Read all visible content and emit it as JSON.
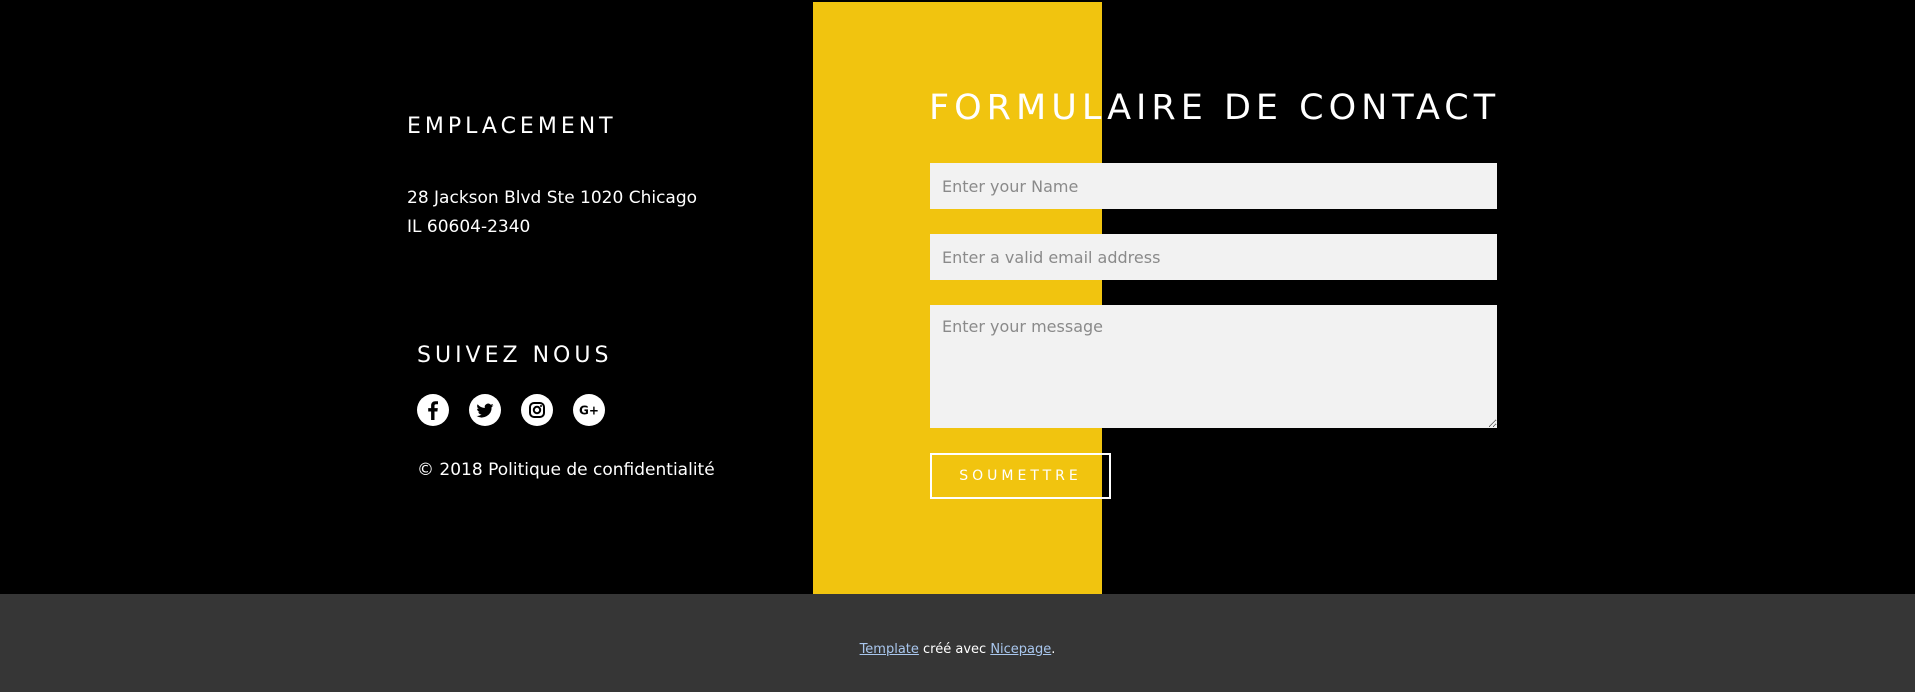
{
  "location": {
    "heading": "EMPLACEMENT",
    "address_line1": "28 Jackson Blvd Ste 1020 Chicago",
    "address_line2": "IL 60604-2340"
  },
  "social": {
    "heading": "SUIVEZ NOUS",
    "icons": [
      "facebook-icon",
      "twitter-icon",
      "instagram-icon",
      "google-plus-icon"
    ],
    "google_plus_label": "G+"
  },
  "copyright": "© 2018 Politique de confidentialité",
  "contact_form": {
    "heading": "FORMULAIRE DE CONTACT",
    "name_placeholder": "Enter your Name",
    "email_placeholder": "Enter a valid email address",
    "message_placeholder": "Enter your message",
    "submit_label": "SOUMETTRE"
  },
  "footer": {
    "template_link": "Template",
    "middle_text": " créé avec ",
    "nicepage_link": "Nicepage",
    "end_text": "."
  },
  "colors": {
    "accent_yellow": "#f1c40f",
    "background": "#000000",
    "footer_bg": "#363636",
    "input_bg": "#f2f2f2"
  }
}
